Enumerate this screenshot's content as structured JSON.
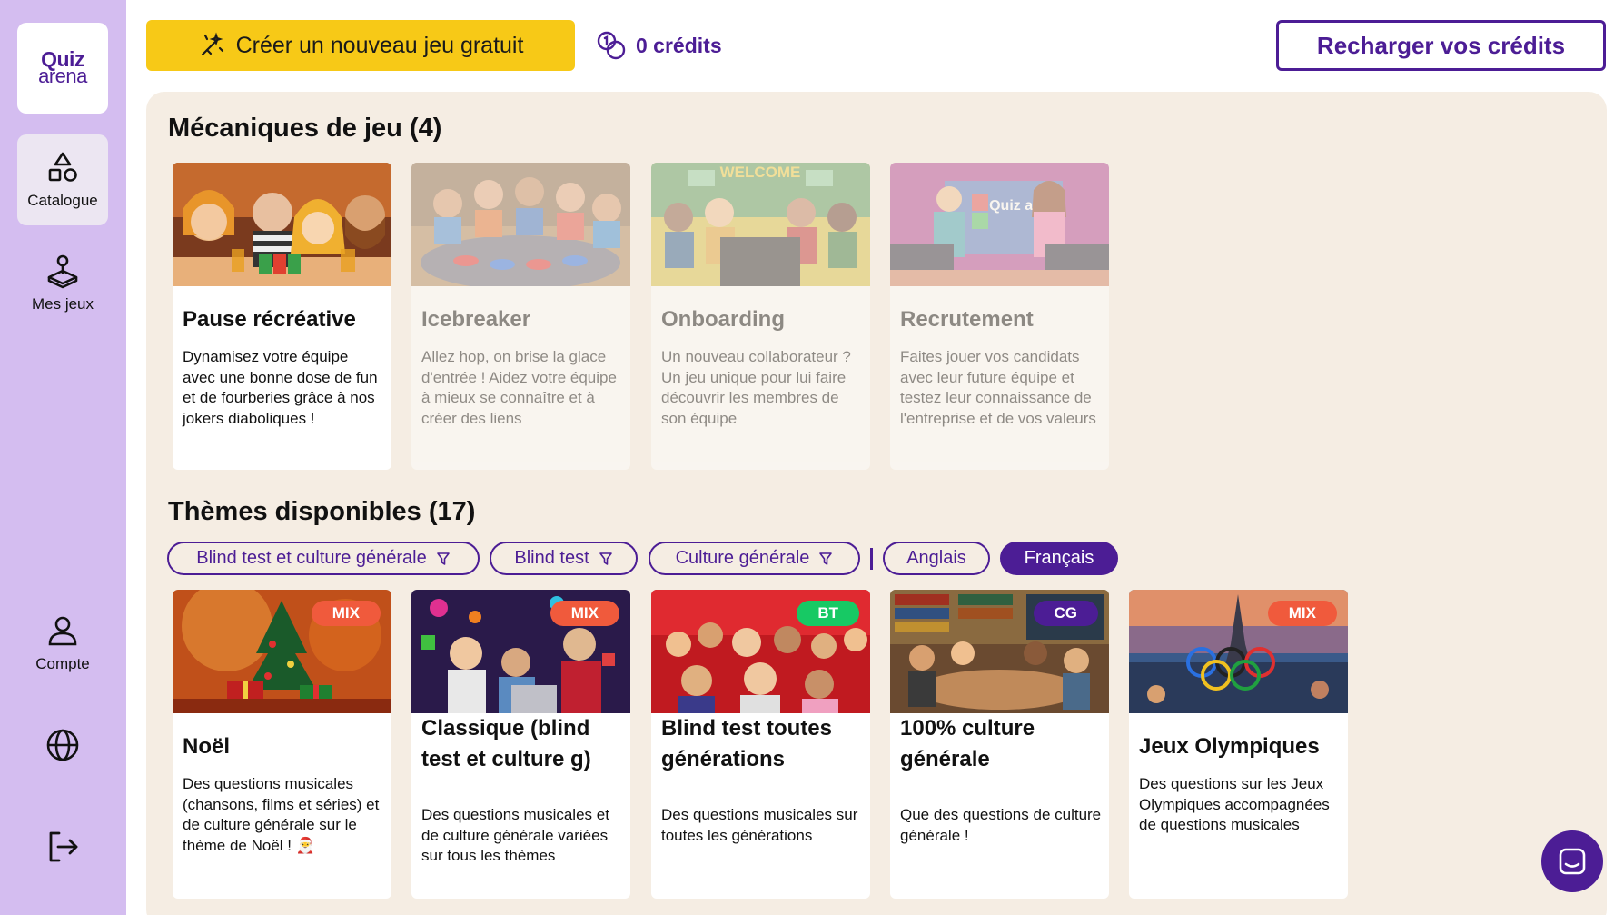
{
  "logo": {
    "line1": "Quiz",
    "line2": "arena"
  },
  "sidebar": {
    "catalogue": "Catalogue",
    "mes_jeux": "Mes jeux",
    "compte": "Compte"
  },
  "topbar": {
    "create_label": "Créer un nouveau jeu gratuit",
    "credits_label": "0 crédits",
    "recharge_label": "Recharger vos crédits"
  },
  "mechanics": {
    "title": "Mécaniques de jeu (4)",
    "cards": [
      {
        "title": "Pause récréative",
        "desc": "Dynamisez votre équipe avec une bonne dose de fun et de fourberies grâce à nos jokers diaboliques !"
      },
      {
        "title": "Icebreaker",
        "desc": "Allez hop, on brise la glace d'entrée ! Aidez votre équipe à mieux se connaître et à créer des liens"
      },
      {
        "title": "Onboarding",
        "desc": "Un nouveau collaborateur ? Un jeu unique pour lui faire découvrir les membres de son équipe",
        "img_text": "WELCOME"
      },
      {
        "title": "Recrutement",
        "desc": "Faites jouer vos candidats avec leur future équipe et testez leur connaissance de l'entreprise et de vos valeurs",
        "img_text": "Quiz arena"
      }
    ]
  },
  "themes": {
    "title": "Thèmes disponibles (17)",
    "filters": [
      {
        "label": "Blind test et culture générale"
      },
      {
        "label": "Blind test"
      },
      {
        "label": "Culture générale"
      },
      {
        "label": "Anglais"
      },
      {
        "label": "Français"
      }
    ],
    "cards": [
      {
        "title": "Noël",
        "badge": "MIX",
        "desc": "Des questions musicales (chansons, films et séries) et de culture générale sur le thème de Noël ! 🎅"
      },
      {
        "title": "Classique (blind test et culture g)",
        "badge": "MIX",
        "desc": "Des questions musicales et de culture générale variées sur tous les thèmes"
      },
      {
        "title": "Blind test toutes générations",
        "badge": "BT",
        "desc": "Des questions musicales sur toutes les générations"
      },
      {
        "title": "100% culture générale",
        "badge": "CG",
        "desc": "Que des questions de culture générale !"
      },
      {
        "title": "Jeux Olympiques",
        "badge": "MIX",
        "desc": "Des questions sur les Jeux Olympiques accompagnées de questions musicales"
      }
    ]
  },
  "colors": {
    "accent": "#4c1d95",
    "sidebar": "#d4bdf0",
    "yellow": "#f7c917",
    "panel": "#f5ede3",
    "badge_mix": "#f05a3c",
    "badge_bt": "#17c964",
    "badge_cg": "#4c1d95"
  }
}
